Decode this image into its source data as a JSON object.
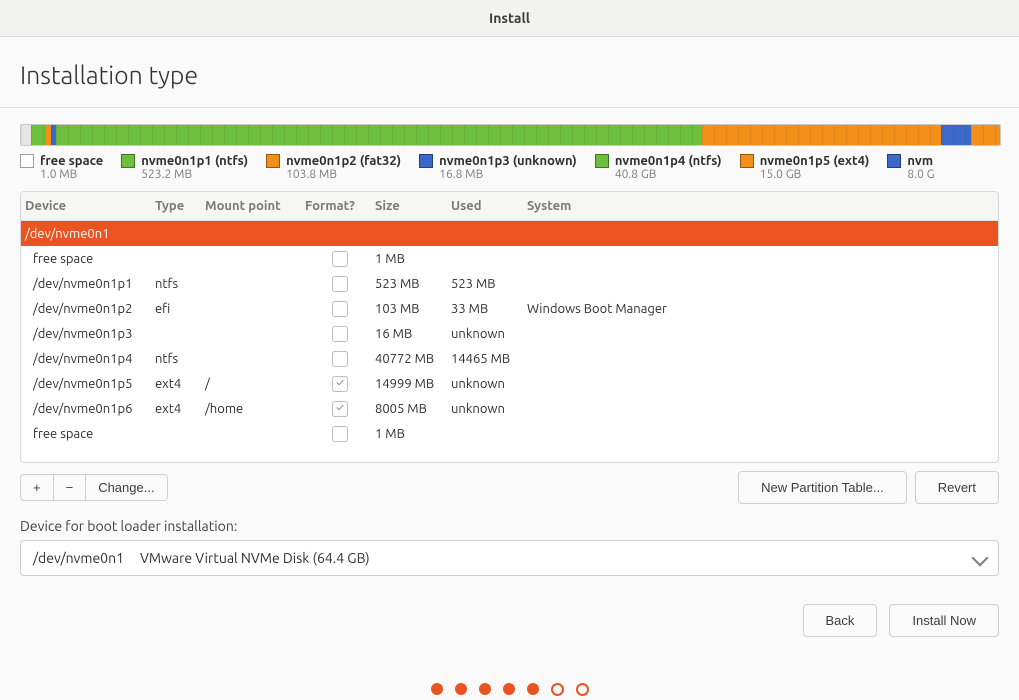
{
  "window_title": "Install",
  "page_title": "Installation type",
  "colors": {
    "orange": "#e95420",
    "green_ntfs": "#6fbf3f",
    "orange_fat32": "#f39019",
    "blue_unknown": "#3b68c9",
    "green_ntfs2": "#6fbf3f",
    "orange_ext4": "#f39019",
    "blue_ext4b": "#3b68c9",
    "free_space": "#e6e6e6"
  },
  "bar": [
    {
      "width_pct": 1,
      "color": "#e6e6e6"
    },
    {
      "width_pct": 1.5,
      "color": "#6fbf3f"
    },
    {
      "width_pct": 0.6,
      "color": "#f39019"
    },
    {
      "width_pct": 0.5,
      "color": "#3b68c9"
    },
    {
      "width_pct": 66.0,
      "color": "#6fbf3f"
    },
    {
      "width_pct": 24.4,
      "color": "#f39019"
    },
    {
      "width_pct": 3.0,
      "color": "#3b68c9"
    },
    {
      "width_pct": 3.0,
      "color": "#f39019"
    }
  ],
  "legend": [
    {
      "label": "free space",
      "sub": "1.0 MB",
      "color": "#ffffff",
      "border": "#9e9e9e"
    },
    {
      "label": "nvme0n1p1 (ntfs)",
      "sub": "523.2 MB",
      "color": "#6fbf3f"
    },
    {
      "label": "nvme0n1p2 (fat32)",
      "sub": "103.8 MB",
      "color": "#f39019"
    },
    {
      "label": "nvme0n1p3 (unknown)",
      "sub": "16.8 MB",
      "color": "#3b68c9"
    },
    {
      "label": "nvme0n1p4 (ntfs)",
      "sub": "40.8 GB",
      "color": "#6fbf3f"
    },
    {
      "label": "nvme0n1p5 (ext4)",
      "sub": "15.0 GB",
      "color": "#f39019"
    },
    {
      "label": "nvm",
      "sub": "8.0 G",
      "color": "#3b68c9"
    }
  ],
  "columns": [
    "Device",
    "Type",
    "Mount point",
    "Format?",
    "Size",
    "Used",
    "System"
  ],
  "rows": [
    {
      "device": "/dev/nvme0n1",
      "type": "",
      "mount": "",
      "fmt": null,
      "size": "",
      "used": "",
      "system": "",
      "selected": true
    },
    {
      "device": "free space",
      "type": "",
      "mount": "",
      "fmt": false,
      "size": "1 MB",
      "used": "",
      "system": ""
    },
    {
      "device": "/dev/nvme0n1p1",
      "type": "ntfs",
      "mount": "",
      "fmt": false,
      "size": "523 MB",
      "used": "523 MB",
      "system": ""
    },
    {
      "device": "/dev/nvme0n1p2",
      "type": "efi",
      "mount": "",
      "fmt": false,
      "size": "103 MB",
      "used": "33 MB",
      "system": "Windows Boot Manager"
    },
    {
      "device": "/dev/nvme0n1p3",
      "type": "",
      "mount": "",
      "fmt": false,
      "size": "16 MB",
      "used": "unknown",
      "system": ""
    },
    {
      "device": "/dev/nvme0n1p4",
      "type": "ntfs",
      "mount": "",
      "fmt": false,
      "size": "40772 MB",
      "used": "14465 MB",
      "system": ""
    },
    {
      "device": "/dev/nvme0n1p5",
      "type": "ext4",
      "mount": "/",
      "fmt": true,
      "size": "14999 MB",
      "used": "unknown",
      "system": ""
    },
    {
      "device": "/dev/nvme0n1p6",
      "type": "ext4",
      "mount": "/home",
      "fmt": true,
      "size": "8005 MB",
      "used": "unknown",
      "system": ""
    },
    {
      "device": "free space",
      "type": "",
      "mount": "",
      "fmt": false,
      "size": "1 MB",
      "used": "",
      "system": ""
    }
  ],
  "toolbar": {
    "add": "+",
    "remove": "−",
    "change": "Change...",
    "new_table": "New Partition Table...",
    "revert": "Revert"
  },
  "bootloader": {
    "label": "Device for boot loader installation:",
    "device": "/dev/nvme0n1",
    "desc": "VMware Virtual NVMe Disk (64.4 GB)"
  },
  "footer": {
    "back": "Back",
    "install": "Install Now"
  },
  "progress": {
    "total": 7,
    "current": 5
  }
}
